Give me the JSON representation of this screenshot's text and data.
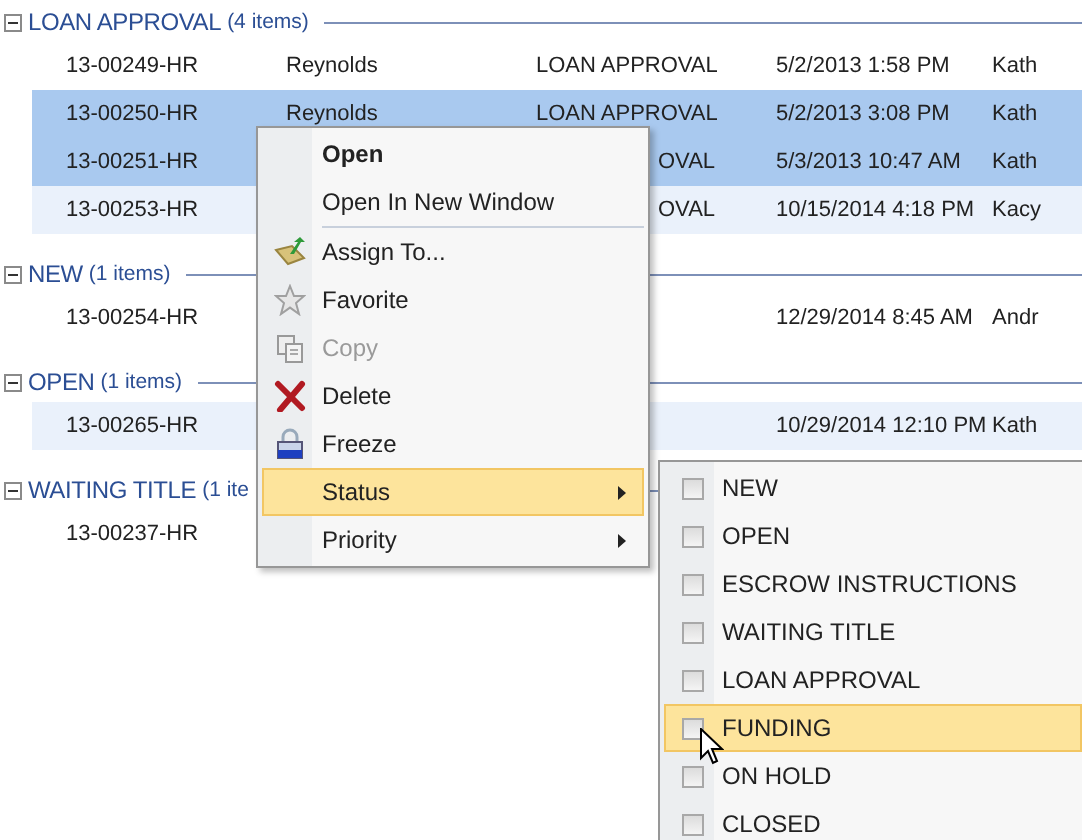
{
  "groups": [
    {
      "title": "LOAN APPROVAL",
      "count": "(4 items)",
      "expanded": true,
      "rows": [
        {
          "id": "13-00249-HR",
          "name": "Reynolds",
          "status": "LOAN APPROVAL",
          "date": "5/2/2013 1:58 PM",
          "person": "Kath",
          "selected": false
        },
        {
          "id": "13-00250-HR",
          "name": "Reynolds",
          "status": "LOAN APPROVAL",
          "date": "5/2/2013 3:08 PM",
          "person": "Kath",
          "selected": true
        },
        {
          "id": "13-00251-HR",
          "status": "OVAL",
          "date": "5/3/2013 10:47 AM",
          "person": "Kath",
          "selected": true
        },
        {
          "id": "13-00253-HR",
          "status": "OVAL",
          "date": "10/15/2014 4:18 PM",
          "person": "Kacy",
          "selected": false
        }
      ]
    },
    {
      "title": "NEW",
      "count": "(1 items)",
      "expanded": true,
      "rows": [
        {
          "id": "13-00254-HR",
          "date": "12/29/2014 8:45 AM",
          "person": "Andr",
          "selected": false
        }
      ]
    },
    {
      "title": "OPEN",
      "count": "(1 items)",
      "expanded": true,
      "rows": [
        {
          "id": "13-00265-HR",
          "date": "10/29/2014 12:10 PM",
          "person": "Kath",
          "selected": false
        }
      ]
    },
    {
      "title": "WAITING TITLE",
      "count": "(1 ite",
      "expanded": true,
      "rows": [
        {
          "id": "13-00237-HR",
          "selected": false
        }
      ]
    }
  ],
  "context_menu": {
    "items": [
      {
        "kind": "command",
        "label": "Open",
        "bold": true,
        "disabled": false,
        "highlighted": false
      },
      {
        "kind": "command",
        "label": "Open In New Window",
        "bold": false,
        "disabled": false,
        "highlighted": false
      },
      {
        "kind": "separator"
      },
      {
        "kind": "command",
        "label": "Assign To...",
        "bold": false,
        "disabled": false,
        "highlighted": false
      },
      {
        "kind": "command",
        "label": "Favorite",
        "bold": false,
        "disabled": false,
        "highlighted": false
      },
      {
        "kind": "command",
        "label": "Copy",
        "bold": false,
        "disabled": true,
        "highlighted": false
      },
      {
        "kind": "command",
        "label": "Delete",
        "bold": false,
        "disabled": false,
        "highlighted": false
      },
      {
        "kind": "command",
        "label": "Freeze",
        "bold": false,
        "disabled": false,
        "highlighted": false
      },
      {
        "kind": "submenu",
        "label": "Status",
        "bold": false,
        "disabled": false,
        "highlighted": true
      },
      {
        "kind": "submenu",
        "label": "Priority",
        "bold": false,
        "disabled": false,
        "highlighted": false
      }
    ]
  },
  "status_submenu": {
    "items": [
      {
        "label": "NEW",
        "checked": false,
        "highlighted": false
      },
      {
        "label": "OPEN",
        "checked": false,
        "highlighted": false
      },
      {
        "label": "ESCROW INSTRUCTIONS",
        "checked": false,
        "highlighted": false
      },
      {
        "label": "WAITING TITLE",
        "checked": false,
        "highlighted": false
      },
      {
        "label": "LOAN APPROVAL",
        "checked": false,
        "highlighted": false
      },
      {
        "label": "FUNDING",
        "checked": false,
        "highlighted": true
      },
      {
        "label": "ON HOLD",
        "checked": false,
        "highlighted": false
      },
      {
        "label": "CLOSED",
        "checked": false,
        "highlighted": false
      }
    ]
  }
}
